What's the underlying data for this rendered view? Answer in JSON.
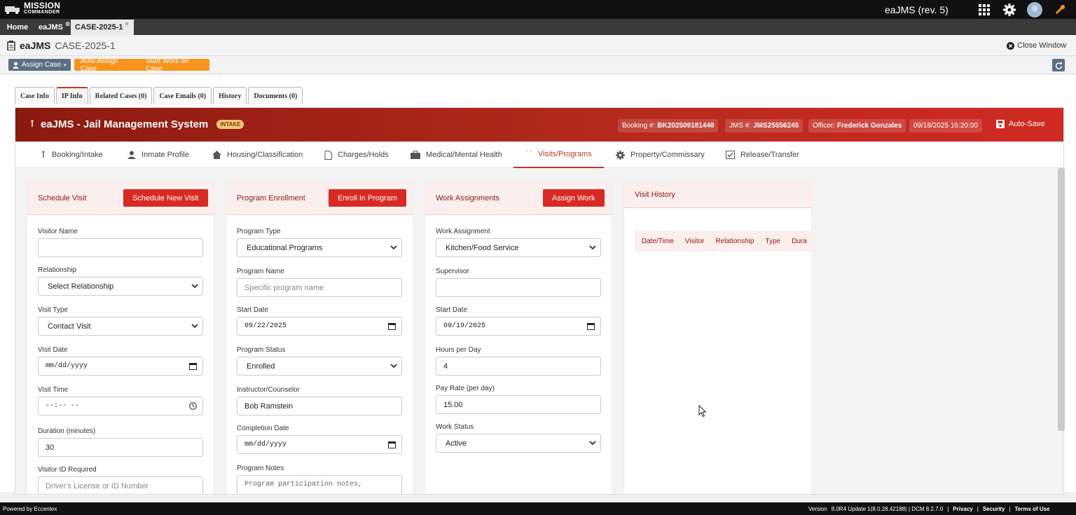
{
  "brand": {
    "line1": "MISSION",
    "line2": "COMMANDER"
  },
  "app_title": "eaJMS (rev. 5)",
  "top_tabs": [
    {
      "label": "Home"
    },
    {
      "label": "eaJMS"
    },
    {
      "label": "CASE-2025-1"
    }
  ],
  "case_header": {
    "app": "eaJMS",
    "case_id": "CASE-2025-1",
    "close_label": "Close Window"
  },
  "actions": {
    "assign": "Assign Case",
    "auto_assign": "Auto-Assign Case",
    "start_work": "Start Work on Case"
  },
  "content_tabs": [
    "Case Info",
    "IP Info",
    "Related Cases (0)",
    "Case Emails (0)",
    "History",
    "Documents (0)"
  ],
  "active_content_tab": "IP Info",
  "jms_header": {
    "title": "eaJMS - Jail Management System",
    "status_badge": "INTAKE",
    "booking_label": "Booking #:",
    "booking_value": "BK202509181448",
    "jms_label": "JMS #:",
    "jms_value": "JMS25556245",
    "officer_label": "Officer:",
    "officer_value": "Frederick Gonzales",
    "datetime": "09/18/2025 16:20:00",
    "autosave": "Auto-Save"
  },
  "subnav": [
    {
      "label": "Booking/Intake",
      "icon": "walking-icon"
    },
    {
      "label": "Inmate Profile",
      "icon": "user-icon"
    },
    {
      "label": "Housing/Classification",
      "icon": "home-icon"
    },
    {
      "label": "Charges/Holds",
      "icon": "document-icon"
    },
    {
      "label": "Medical/Mental Health",
      "icon": "briefcase-icon"
    },
    {
      "label": "Visits/Programs",
      "icon": "dots-icon"
    },
    {
      "label": "Property/Commissary",
      "icon": "gear-icon"
    },
    {
      "label": "Release/Transfer",
      "icon": "check-square-icon"
    }
  ],
  "active_subnav": "Visits/Programs",
  "schedule_visit": {
    "title": "Schedule Visit",
    "button": "Schedule New Visit",
    "visitor_name_label": "Visitor Name",
    "visitor_name_value": "",
    "relationship_label": "Relationship",
    "relationship_value": "Select Relationship",
    "visit_type_label": "Visit Type",
    "visit_type_value": "Contact Visit",
    "visit_date_label": "Visit Date",
    "visit_date_value": "mm/dd/yyyy",
    "visit_time_label": "Visit Time",
    "visit_time_value": "--:-- --",
    "duration_label": "Duration (minutes)",
    "duration_value": "30",
    "visitor_id_label": "Visitor ID Required",
    "visitor_id_placeholder": "Driver's License or ID Number"
  },
  "program_enrollment": {
    "title": "Program Enrollment",
    "button": "Enroll in Program",
    "program_type_label": "Program Type",
    "program_type_value": "Educational Programs",
    "program_name_label": "Program Name",
    "program_name_placeholder": "Specific program name",
    "start_date_label": "Start Date",
    "start_date_value": "09/22/2025",
    "status_label": "Program Status",
    "status_value": "Enrolled",
    "instructor_label": "Instructor/Counselor",
    "instructor_value": "Bob Ramstein",
    "completion_label": "Completion Date",
    "completion_value": "mm/dd/yyyy",
    "notes_label": "Program Notes",
    "notes_placeholder": "Program participation notes,"
  },
  "work_assignments": {
    "title": "Work Assignments",
    "button": "Assign Work",
    "assignment_label": "Work Assignment",
    "assignment_value": "Kitchen/Food Service",
    "supervisor_label": "Supervisor",
    "supervisor_value": "",
    "start_date_label": "Start Date",
    "start_date_value": "09/19/2025",
    "hours_label": "Hours per Day",
    "hours_value": "4",
    "pay_label": "Pay Rate (per day)",
    "pay_value": "15.00",
    "status_label": "Work Status",
    "status_value": "Active"
  },
  "visit_history": {
    "title": "Visit History",
    "columns": [
      "Date/Time",
      "Visitor",
      "Relationship",
      "Type",
      "Dura"
    ]
  },
  "footer": {
    "powered": "Powered by Eccentex",
    "version_label": "Version",
    "version_value": "8.0R4 Update 1(8.0.28.42188) | DCM 8.2.7.0",
    "links": [
      "Privacy",
      "Security",
      "Terms of Use"
    ]
  },
  "colors": {
    "primary_red": "#d82a23",
    "dark_red": "#8b1a10",
    "orange": "#f7941d",
    "slate": "#5b6f82"
  }
}
